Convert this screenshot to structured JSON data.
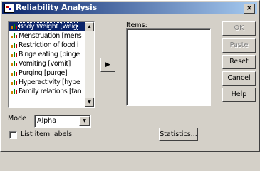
{
  "window": {
    "title": "Reliability Analysis",
    "close_label": "×"
  },
  "variables": [
    "Body Weight [weig",
    "Menstruation [mens",
    "Restriction of food i",
    "Binge eating [binge",
    "Vomiting [vomit]",
    "Purging [purge]",
    "Hyperactivity [hype",
    "Family relations [fan"
  ],
  "transfer_arrow": "▶",
  "items": {
    "label": "Items:"
  },
  "buttons": {
    "ok": "OK",
    "paste": "Paste",
    "reset": "Reset",
    "cancel": "Cancel",
    "help": "Help",
    "statistics": "Statistics..."
  },
  "mode": {
    "label": "Mode",
    "value": "Alpha"
  },
  "list_item_labels": {
    "label": "List item labels",
    "checked": false
  },
  "icons": {
    "scroll_up": "▲",
    "scroll_down": "▼",
    "combo_down": "▼"
  }
}
